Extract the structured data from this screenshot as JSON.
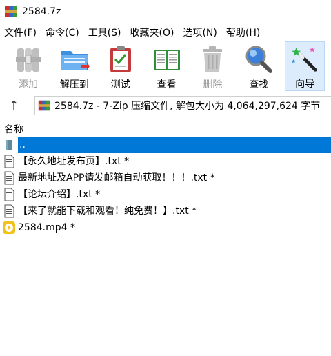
{
  "window": {
    "title": "2584.7z"
  },
  "menu": [
    {
      "label": "文件(F)"
    },
    {
      "label": "命令(C)"
    },
    {
      "label": "工具(S)"
    },
    {
      "label": "收藏夹(O)"
    },
    {
      "label": "选项(N)"
    },
    {
      "label": "帮助(H)"
    }
  ],
  "toolbar": [
    {
      "label": "添加",
      "icon": "archive-add-icon",
      "enabled": false
    },
    {
      "label": "解压到",
      "icon": "extract-folder-icon",
      "enabled": true
    },
    {
      "label": "测试",
      "icon": "test-clipboard-icon",
      "enabled": true
    },
    {
      "label": "查看",
      "icon": "view-book-icon",
      "enabled": true
    },
    {
      "label": "删除",
      "icon": "trash-icon",
      "enabled": false
    },
    {
      "label": "查找",
      "icon": "magnifier-icon",
      "enabled": true
    },
    {
      "label": "向导",
      "icon": "wizard-wand-icon",
      "enabled": true,
      "selected": true
    }
  ],
  "pathbar": {
    "text": "2584.7z - 7-Zip 压缩文件, 解包大小为 4,064,297,624 字节"
  },
  "list": {
    "column_name": "名称",
    "rows": [
      {
        "name": "..",
        "icon": "parent-folder-icon",
        "selected": true
      },
      {
        "name": "【永久地址发布页】.txt *",
        "icon": "text-file-icon"
      },
      {
        "name": "最新地址及APP请发邮箱自动获取！！！.txt *",
        "icon": "text-file-icon"
      },
      {
        "name": "【论坛介绍】.txt *",
        "icon": "text-file-icon"
      },
      {
        "name": "【来了就能下载和观看！纯免费！】.txt *",
        "icon": "text-file-icon"
      },
      {
        "name": "2584.mp4 *",
        "icon": "video-file-icon"
      }
    ]
  },
  "colors": {
    "selection": "#0078d7",
    "toolbar_selected": "#dcecfc"
  }
}
